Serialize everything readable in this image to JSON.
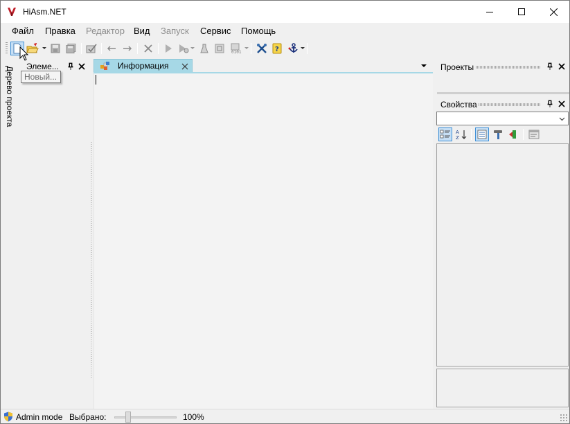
{
  "window": {
    "title": "HiAsm.NET",
    "brand_color": "#c0202a"
  },
  "menu": {
    "items": [
      {
        "label": "Файл",
        "enabled": true
      },
      {
        "label": "Правка",
        "enabled": true
      },
      {
        "label": "Редактор",
        "enabled": false
      },
      {
        "label": "Вид",
        "enabled": true
      },
      {
        "label": "Запуск",
        "enabled": false
      },
      {
        "label": "Сервис",
        "enabled": true
      },
      {
        "label": "Помощь",
        "enabled": true
      }
    ]
  },
  "toolbar": {
    "buttons": [
      {
        "icon": "new-file-icon",
        "active": true
      },
      {
        "icon": "open-folder-icon",
        "active": false
      },
      {
        "icon": "save-icon",
        "active": false
      },
      {
        "icon": "save-all-icon",
        "active": false
      },
      {
        "icon": "check-icon",
        "active": false
      },
      {
        "icon": "back-arrow-icon",
        "active": false
      },
      {
        "icon": "forward-arrow-icon",
        "active": false
      },
      {
        "icon": "delete-icon",
        "active": false
      },
      {
        "icon": "run-icon",
        "active": false
      },
      {
        "icon": "run-options-icon",
        "active": false
      },
      {
        "icon": "flask-icon",
        "active": false
      },
      {
        "icon": "debug-icon",
        "active": false
      },
      {
        "icon": "binary-icon",
        "active": false
      },
      {
        "icon": "tools-icon",
        "active": false
      },
      {
        "icon": "help-icon",
        "active": false
      },
      {
        "icon": "anchor-icon",
        "active": false
      }
    ]
  },
  "tooltip": {
    "text": "Новый..."
  },
  "left_sidebar": {
    "vertical_tab": "Дерево проекта",
    "elements_caption": "Элеме..."
  },
  "document": {
    "tab_label": "Информация",
    "tab_color": "#a6d8e6"
  },
  "right_panels": {
    "projects_caption": "Проекты",
    "properties_caption": "Свойства",
    "properties_combo_value": ""
  },
  "statusbar": {
    "mode": "Admin mode",
    "selected_label": "Выбрано:",
    "zoom": "100%",
    "zoom_slider_fraction": 0.2
  }
}
